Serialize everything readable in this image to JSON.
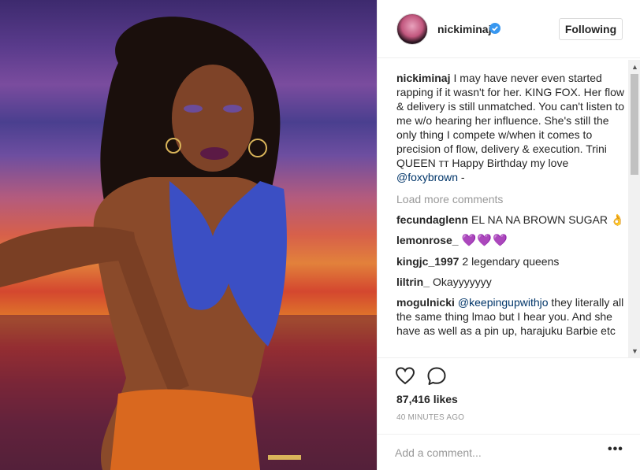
{
  "post": {
    "username": "nickiminaj",
    "follow_label": "Following",
    "caption_user": "nickiminaj",
    "caption_text": "I may have never even started rapping if it wasn't for her. KING FOX. Her flow & delivery is still unmatched. You can't listen to me w/o hearing her influence. She's still the only thing I compete w/when it comes to precision of flow, delivery & execution. Trini QUEEN тт Happy Birthday my love ",
    "caption_mention": "@foxybrown",
    "caption_tail": " -",
    "load_more": "Load more comments",
    "comments": [
      {
        "user": "fecundaglenn",
        "text": "EL NA NA BROWN SUGAR 👌"
      },
      {
        "user": "lemonrose_",
        "text": "💜💜💜"
      },
      {
        "user": "kingjc_1997",
        "text": "2 legendary queens"
      },
      {
        "user": "liltrin_",
        "text": "Okayyyyyyy"
      },
      {
        "user": "mogulnicki",
        "mention": "@keepingupwithjo",
        "text": " they literally all the same thing lmao but I hear you. And she have as well as a pin up, harajuku Barbie etc"
      }
    ],
    "likes": "87,416 likes",
    "time": "40 MINUTES AGO",
    "add_comment_placeholder": "Add a comment...",
    "more_label": "•••"
  },
  "icons": {
    "verified": "verified-badge-icon",
    "like": "heart-outline-icon",
    "comment": "speech-bubble-icon",
    "more": "ellipsis-icon"
  },
  "colors": {
    "verified_blue": "#3897f0",
    "mention_blue": "#003569",
    "muted_gray": "#999999"
  }
}
